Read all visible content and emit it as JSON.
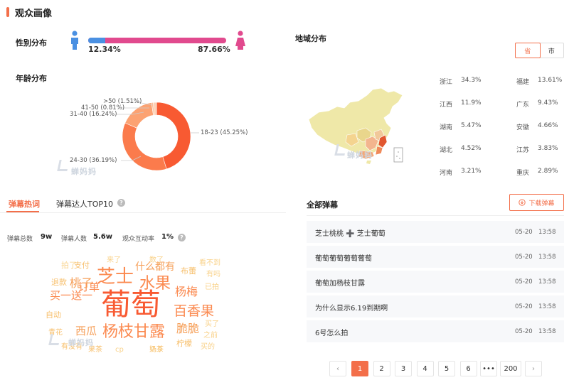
{
  "section": {
    "title": "观众画像"
  },
  "gender": {
    "label": "性别分布",
    "male_pct": "12.34%",
    "female_pct": "87.66%",
    "male_fraction": 0.1234,
    "male_color": "#4a90e2",
    "female_color": "#e14a8e"
  },
  "age": {
    "label": "年龄分布",
    "chart_data": {
      "type": "pie",
      "categories": [
        "18-23",
        "24-30",
        "31-40",
        "41-50",
        ">50"
      ],
      "values": [
        45.25,
        36.19,
        16.24,
        0.81,
        1.51
      ],
      "labels": [
        "18-23 (45.25%)",
        "24-30 (36.19%)",
        "31-40 (16.24%)",
        "41-50 (0.81%)",
        ">50 (1.51%)"
      ],
      "colors": [
        "#f85a32",
        "#fb7b4c",
        "#fca272",
        "#fdbd96",
        "#fdd0b4"
      ]
    }
  },
  "watermark": {
    "text": "蝉妈妈"
  },
  "region": {
    "label": "地域分布",
    "toggle": {
      "province": "省",
      "city": "市"
    },
    "items": [
      {
        "name": "浙江",
        "value": "34.3%"
      },
      {
        "name": "福建",
        "value": "13.61%"
      },
      {
        "name": "江西",
        "value": "11.9%"
      },
      {
        "name": "广东",
        "value": "9.43%"
      },
      {
        "name": "湖南",
        "value": "5.47%"
      },
      {
        "name": "安徽",
        "value": "4.66%"
      },
      {
        "name": "湖北",
        "value": "4.52%"
      },
      {
        "name": "江苏",
        "value": "3.83%"
      },
      {
        "name": "河南",
        "value": "3.21%"
      },
      {
        "name": "重庆",
        "value": "2.89%"
      }
    ]
  },
  "danmu_tabs": {
    "hot": "弹幕热词",
    "top": "弹幕达人TOP10"
  },
  "danmu_stats": {
    "total_label": "弹幕总数",
    "total_value": "9w",
    "people_label": "弹幕人数",
    "people_value": "5.6w",
    "rate_label": "观众互动率",
    "rate_value": "1%"
  },
  "wordcloud": {
    "words": [
      "葡萄",
      "芝士",
      "水果",
      "杨枝甘露",
      "订单",
      "买一送一",
      "百香果",
      "杨梅",
      "桃子",
      "西瓜",
      "什么都有",
      "脆脆",
      "支付",
      "退款",
      "自动",
      "布蕾",
      "柠檬",
      "奶茶",
      "青花",
      "果茶",
      "cp",
      "9.9",
      "已拍",
      "买了",
      "之前",
      "来了",
      "有没有",
      "数了",
      "拍了",
      "看不到",
      "有吗",
      "买的"
    ],
    "colors": [
      "#f85a32",
      "#fb8a50",
      "#f6a05a",
      "#f7bf6b",
      "#f9d28a"
    ]
  },
  "all_danmu": {
    "title": "全部弹幕",
    "download": "下载弹幕",
    "rows": [
      {
        "text": "芝士桃桃 ➕ 芝士葡萄",
        "date": "05-20",
        "time": "13:58"
      },
      {
        "text": "葡萄葡萄葡萄葡萄",
        "date": "05-20",
        "time": "13:58"
      },
      {
        "text": "葡萄加杨枝甘露",
        "date": "05-20",
        "time": "13:58"
      },
      {
        "text": "为什么显示6.19到期啊",
        "date": "05-20",
        "time": "13:58"
      },
      {
        "text": "6号怎么拍",
        "date": "05-20",
        "time": "13:58"
      }
    ]
  },
  "pagination": {
    "prev": "‹",
    "pages": [
      "1",
      "2",
      "3",
      "4",
      "5",
      "6"
    ],
    "ellipsis": "•••",
    "last": "200",
    "next": "›"
  },
  "accent_color": "#f36f4a"
}
